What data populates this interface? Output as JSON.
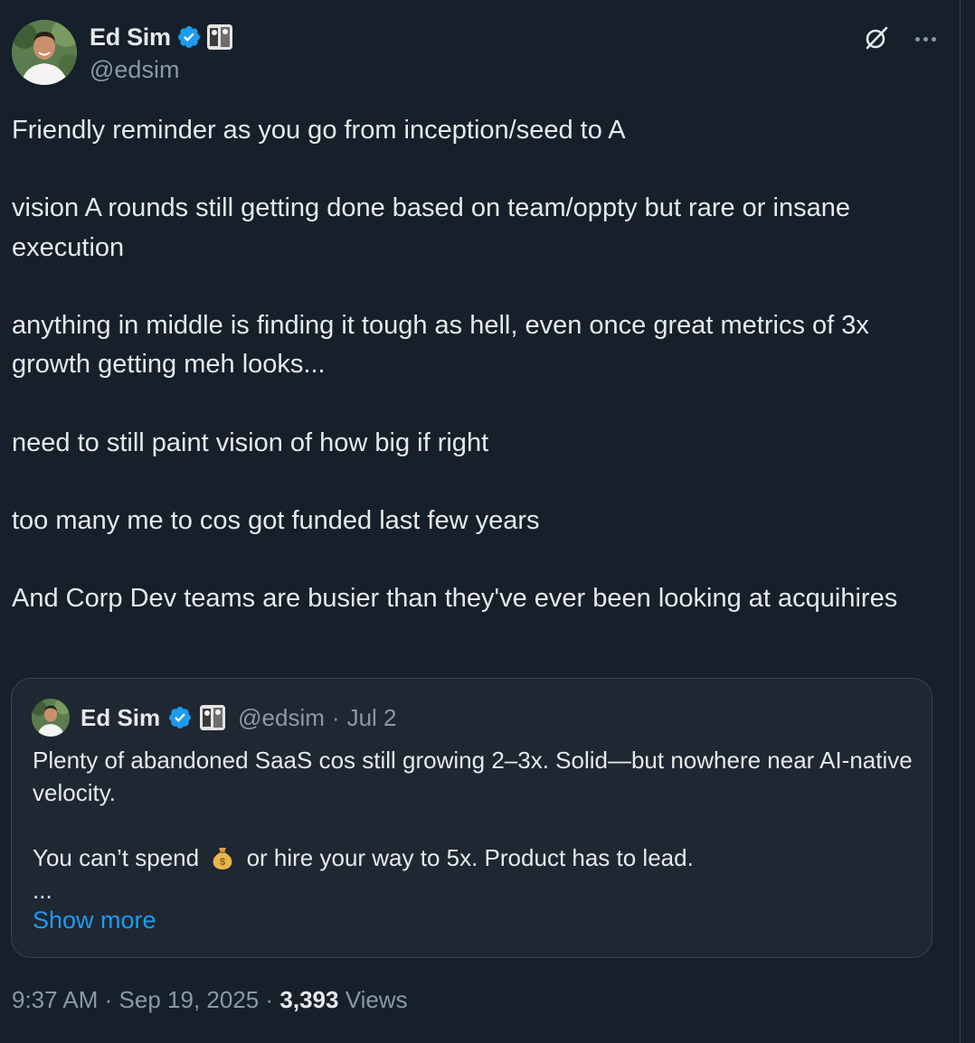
{
  "author": {
    "display_name": "Ed Sim",
    "handle": "@edsim",
    "verified_icon": "verified-badge-icon",
    "affiliate_icon": "affiliate-badge-icon"
  },
  "header_actions": {
    "grok_icon": "grok-icon",
    "more_icon": "more-options-icon"
  },
  "tweet": {
    "paragraphs": [
      "Friendly reminder as you go from inception/seed to A",
      "vision A rounds still getting done based on team/oppty but rare or insane execution",
      "anything in middle is finding it tough as hell, even once great metrics of 3x growth getting meh looks...",
      "need to still paint vision of how big if right",
      "too many me to cos got funded last few years",
      "And Corp Dev teams are busier than they've ever been looking at acquihires"
    ]
  },
  "quote": {
    "display_name": "Ed Sim",
    "handle": "@edsim",
    "separator": "·",
    "date": "Jul 2",
    "line1": "Plenty of abandoned SaaS cos still growing 2–3x. Solid—but nowhere near AI-native velocity.",
    "line2_before": "You can’t spend",
    "line2_emoji": "money-bag-icon",
    "line2_after": "or hire your way to 5x. Product has to lead.",
    "ellipsis": "...",
    "show_more": "Show more"
  },
  "footer": {
    "time": "9:37 AM",
    "sep1": "·",
    "date": "Sep 19, 2025",
    "sep2": "·",
    "views_count": "3,393",
    "views_label": "Views"
  }
}
